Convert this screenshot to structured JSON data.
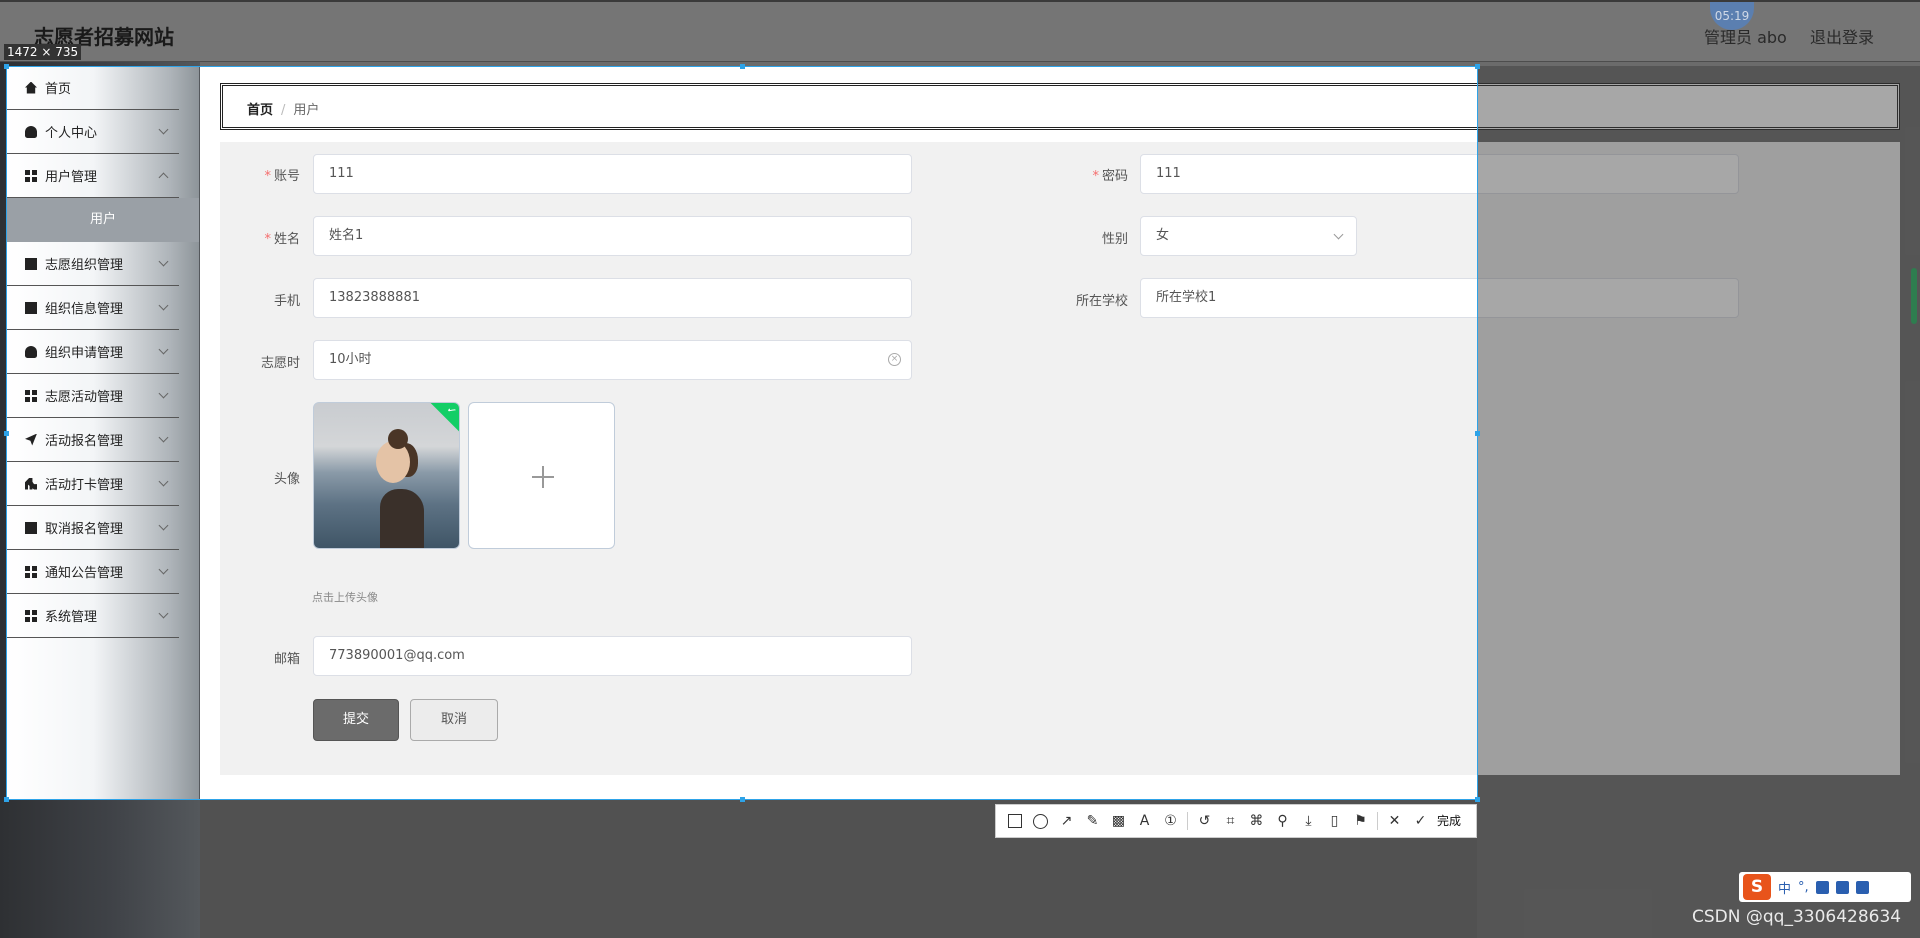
{
  "header": {
    "site_title": "志愿者招募网站",
    "user_text": "管理员 abo",
    "logout": "退出登录",
    "clock": "05:19"
  },
  "capture": {
    "dimension_label": "1472 × 735",
    "done_label": "完成"
  },
  "sidebar": {
    "items": [
      {
        "label": "首页",
        "icon": "home-icon"
      },
      {
        "label": "个人中心",
        "icon": "user-icon"
      },
      {
        "label": "用户管理",
        "icon": "grid-icon"
      },
      {
        "label": "志愿组织管理",
        "icon": "library-icon"
      },
      {
        "label": "组织信息管理",
        "icon": "clipboard-icon"
      },
      {
        "label": "组织申请管理",
        "icon": "person-icon"
      },
      {
        "label": "志愿活动管理",
        "icon": "grid-icon"
      },
      {
        "label": "活动报名管理",
        "icon": "send-icon"
      },
      {
        "label": "活动打卡管理",
        "icon": "bar-chart-icon"
      },
      {
        "label": "取消报名管理",
        "icon": "line-chart-icon"
      },
      {
        "label": "通知公告管理",
        "icon": "grid-icon"
      },
      {
        "label": "系统管理",
        "icon": "grid-icon"
      }
    ],
    "active_sub": "用户"
  },
  "breadcrumb": {
    "home": "首页",
    "separator": "/",
    "current": "用户"
  },
  "form": {
    "account_label": "账号",
    "account_value": "111",
    "password_label": "密码",
    "password_value": "111",
    "name_label": "姓名",
    "name_value": "姓名1",
    "gender_label": "性别",
    "gender_value": "女",
    "phone_label": "手机",
    "phone_value": "13823888881",
    "school_label": "所在学校",
    "school_value": "所在学校1",
    "hours_label": "志愿时",
    "hours_value": "10小时",
    "avatar_label": "头像",
    "avatar_tip": "点击上传头像",
    "email_label": "邮箱",
    "email_value": "773890001@qq.com",
    "required_mark": "*"
  },
  "buttons": {
    "submit": "提交",
    "cancel": "取消"
  },
  "tray": {
    "s_logo": "S",
    "lang": "中"
  },
  "watermark": "CSDN @qq_3306428634",
  "colors": {
    "required": "#f56c6c",
    "upload_success": "#13ce66",
    "selection_border": "#2ea3e8"
  }
}
